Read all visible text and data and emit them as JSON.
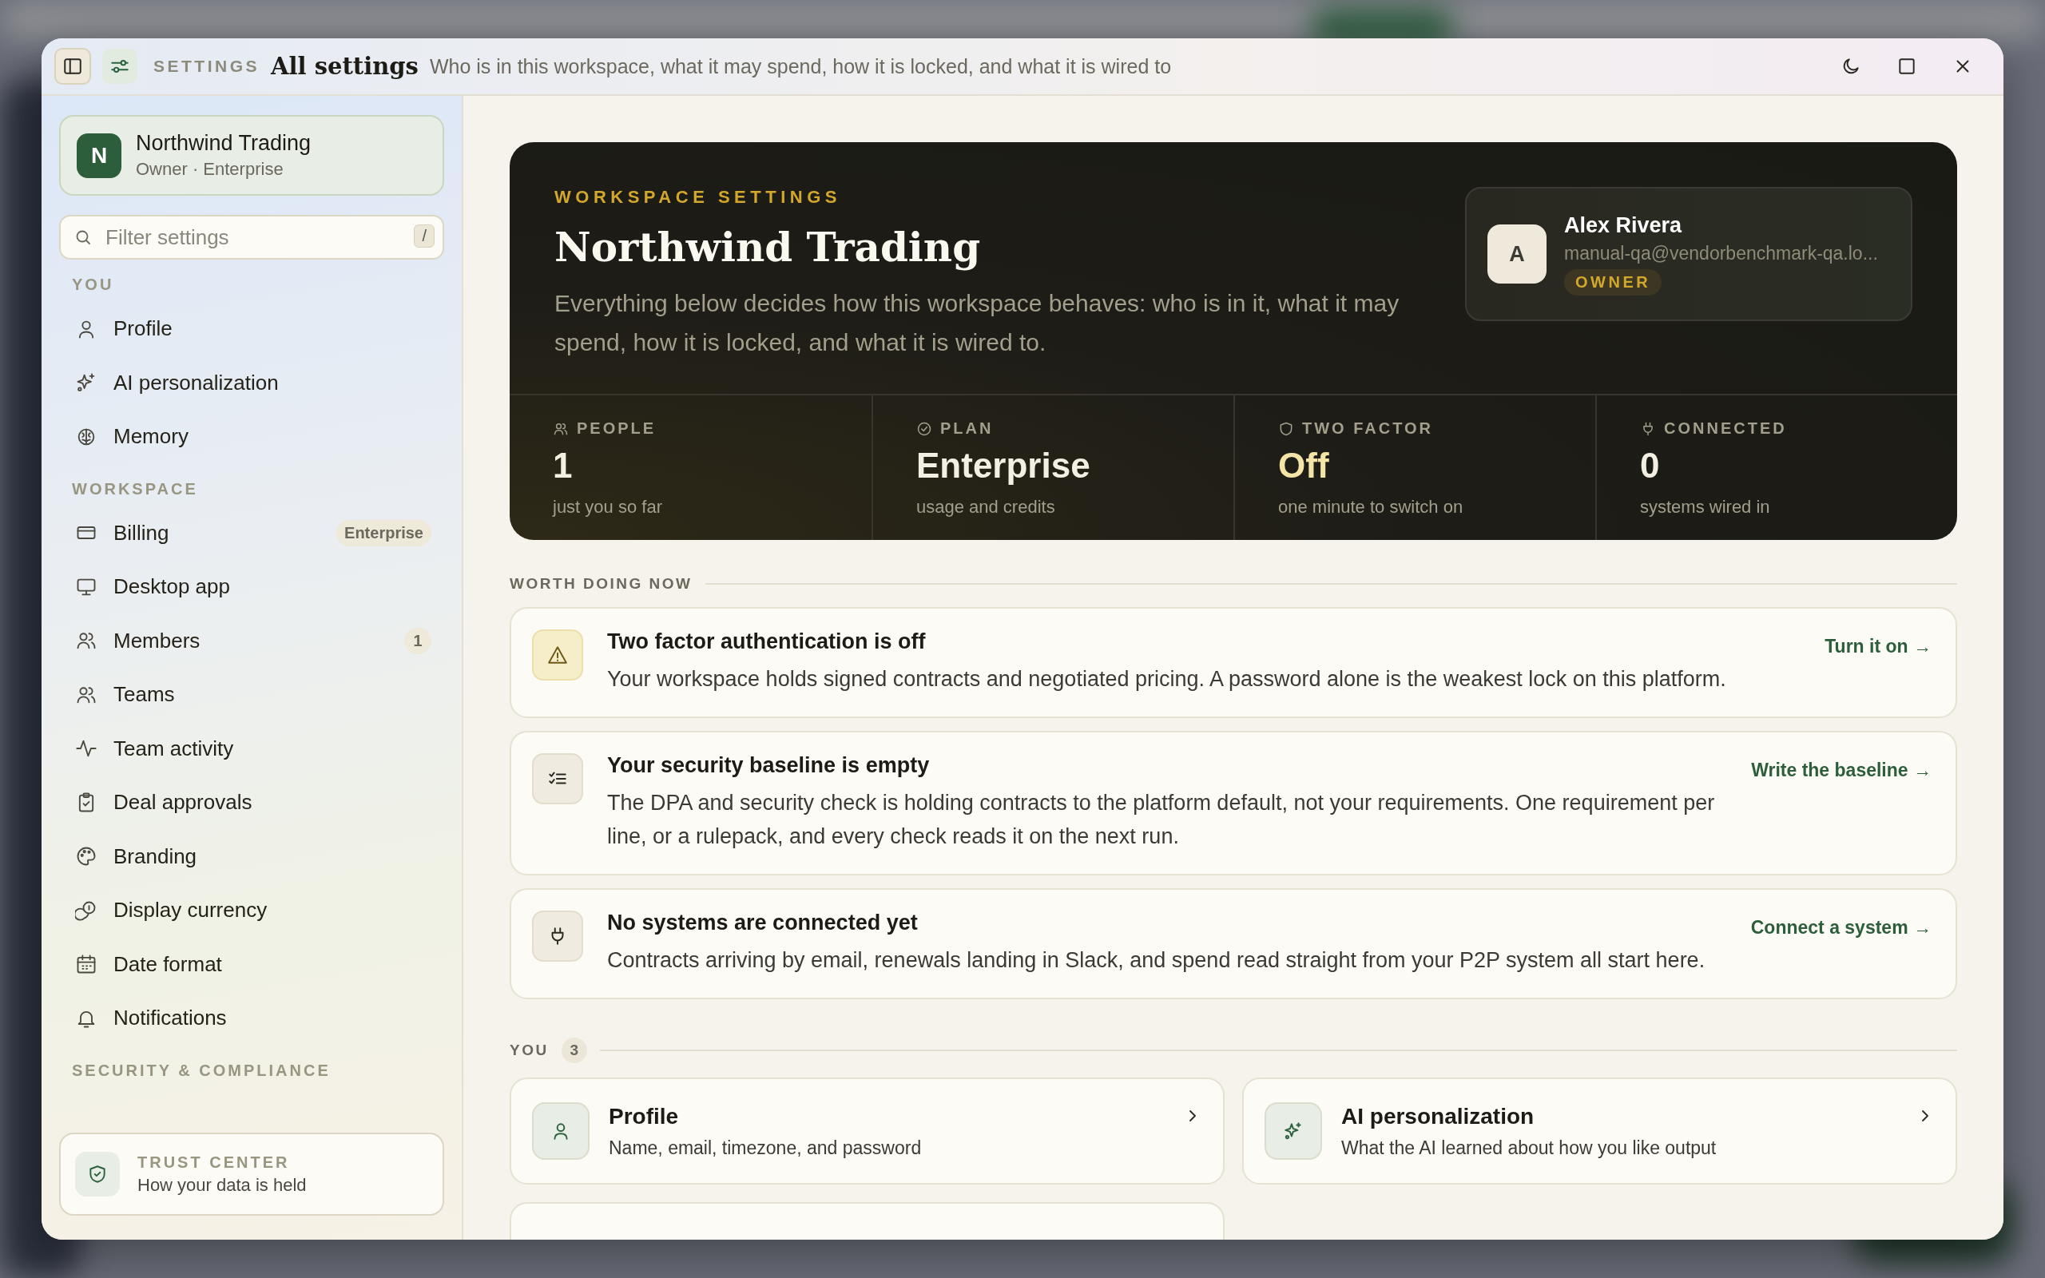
{
  "window": {
    "section": "SETTINGS",
    "title": "All settings",
    "subtitle": "Who is in this workspace, what it may spend, how it is locked, and what it is wired to"
  },
  "sidebar": {
    "org": {
      "initial": "N",
      "name": "Northwind Trading",
      "meta": "Owner · Enterprise"
    },
    "search": {
      "placeholder": "Filter settings",
      "shortcut": "/"
    },
    "groups": [
      {
        "label": "YOU",
        "items": [
          {
            "label": "Profile",
            "selected": false
          },
          {
            "label": "AI personalization",
            "selected": false
          },
          {
            "label": "Memory",
            "selected": false
          }
        ]
      },
      {
        "label": "WORKSPACE",
        "items": [
          {
            "label": "Billing",
            "badge": "Enterprise",
            "selected": false
          },
          {
            "label": "Desktop app",
            "selected": false
          },
          {
            "label": "Members",
            "badge": "1",
            "selected": false
          },
          {
            "label": "Teams",
            "selected": false
          },
          {
            "label": "Team activity",
            "selected": false
          },
          {
            "label": "Deal approvals",
            "selected": false
          },
          {
            "label": "Branding",
            "selected": false
          },
          {
            "label": "Display currency",
            "selected": false
          },
          {
            "label": "Date format",
            "selected": false
          },
          {
            "label": "Notifications",
            "selected": false
          }
        ]
      },
      {
        "label": "SECURITY & COMPLIANCE"
      }
    ],
    "trust": {
      "title": "TRUST CENTER",
      "subtitle": "How your data is held"
    }
  },
  "hero": {
    "eyebrow": "WORKSPACE SETTINGS",
    "title": "Northwind Trading",
    "description": "Everything below decides how this workspace behaves: who is in it, what it may spend, how it is locked, and what it is wired to.",
    "user": {
      "initial": "A",
      "name": "Alex Rivera",
      "email": "manual-qa@vendorbenchmark-qa.lo...",
      "role": "OWNER"
    },
    "stats": [
      {
        "label": "PEOPLE",
        "value": "1",
        "note": "just you so far",
        "color": "#f3efe2"
      },
      {
        "label": "PLAN",
        "value": "Enterprise",
        "note": "usage and credits",
        "color": "#f3efe2"
      },
      {
        "label": "TWO FACTOR",
        "value": "Off",
        "note": "one minute to switch on",
        "color": "#f4e4a8"
      },
      {
        "label": "CONNECTED",
        "value": "0",
        "note": "systems wired in",
        "color": "#f3efe2"
      }
    ]
  },
  "worth_doing": {
    "label": "WORTH DOING NOW",
    "items": [
      {
        "kind": "warning",
        "title": "Two factor authentication is off",
        "body": "Your workspace holds signed contracts and negotiated pricing. A password alone is the weakest lock on this platform.",
        "action": "Turn it on →"
      },
      {
        "kind": "neutral",
        "title": "Your security baseline is empty",
        "body": "The DPA and security check is holding contracts to the platform default, not your requirements. One requirement per line, or a rulepack, and every check reads it on the next run.",
        "action": "Write the baseline →"
      },
      {
        "kind": "neutral",
        "title": "No systems are connected yet",
        "body": "Contracts arriving by email, renewals landing in Slack, and spend read straight from your P2P system all start here.",
        "action": "Connect a system →"
      }
    ]
  },
  "you": {
    "label": "YOU",
    "count": "3",
    "cards": [
      {
        "title": "Profile",
        "subtitle": "Name, email, timezone, and password"
      },
      {
        "title": "AI personalization",
        "subtitle": "What the AI learned about how you like output"
      }
    ]
  }
}
